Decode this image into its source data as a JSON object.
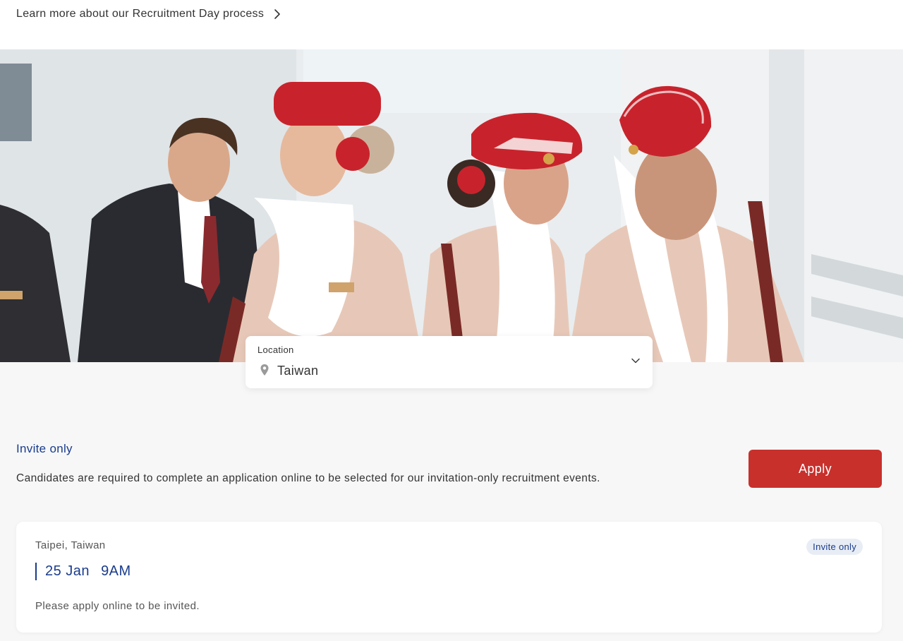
{
  "top": {
    "learn_more_label": "Learn more about our Recruitment Day process"
  },
  "hero": {
    "image_subject": "cabin-crew-group-photo"
  },
  "location": {
    "label": "Location",
    "value": "Taiwan"
  },
  "invite": {
    "heading": "Invite only",
    "description": "Candidates are required to complete an application online to be selected for our invitation-only recruitment events.",
    "apply_label": "Apply"
  },
  "event": {
    "location": "Taipei, Taiwan",
    "badge": "Invite only",
    "date": "25 Jan",
    "time": "9AM",
    "note": "Please apply online to be invited."
  },
  "colors": {
    "accent_red": "#c8302c",
    "accent_blue": "#1a3c8c",
    "background": "#f7f7f7"
  },
  "icons": [
    "chevron-right-icon",
    "map-pin-icon",
    "chevron-down-icon"
  ]
}
